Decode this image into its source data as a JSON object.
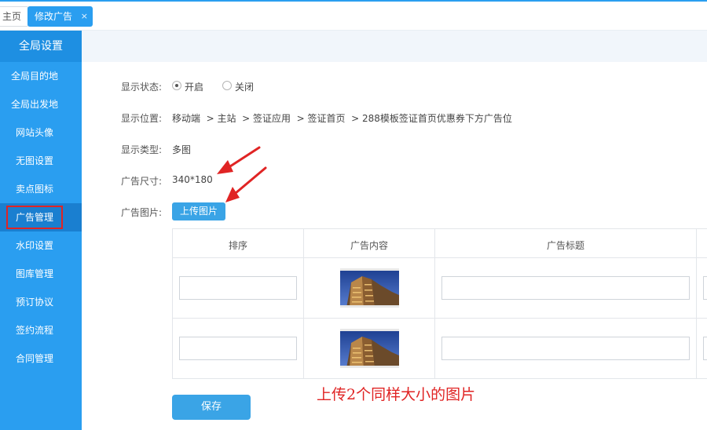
{
  "tabs": {
    "home_label": "主页",
    "active_label": "修改广告",
    "close_glyph": "×"
  },
  "sidebar": {
    "header": "全局设置",
    "items": [
      {
        "label": "全局目的地"
      },
      {
        "label": "全局出发地"
      },
      {
        "label": "网站头像"
      },
      {
        "label": "无图设置"
      },
      {
        "label": "卖点图标"
      },
      {
        "label": "广告管理"
      },
      {
        "label": "水印设置"
      },
      {
        "label": "图库管理"
      },
      {
        "label": "预订协议"
      },
      {
        "label": "签约流程"
      },
      {
        "label": "合同管理"
      }
    ],
    "active_index": 5
  },
  "form": {
    "status_label": "显示状态:",
    "status_on": "开启",
    "status_off": "关闭",
    "status_selected": "开启",
    "position_label": "显示位置:",
    "position_path": "移动端  > 主站  > 签证应用  > 签证首页  > 288模板签证首页优惠券下方广告位",
    "type_label": "显示类型:",
    "type_value": "多图",
    "size_label": "广告尺寸:",
    "size_value": "340*180",
    "image_label": "广告图片:",
    "upload_label": "上传图片"
  },
  "table": {
    "headers": [
      "排序",
      "广告内容",
      "广告标题"
    ],
    "rows": [
      {
        "order": "",
        "title": ""
      },
      {
        "order": "",
        "title": ""
      }
    ]
  },
  "save_label": "保存",
  "annotation": "上传2个同样大小的图片",
  "colors": {
    "accent": "#2a9ef0",
    "annotation_red": "#e02424",
    "button_blue": "#3aa4e6"
  }
}
